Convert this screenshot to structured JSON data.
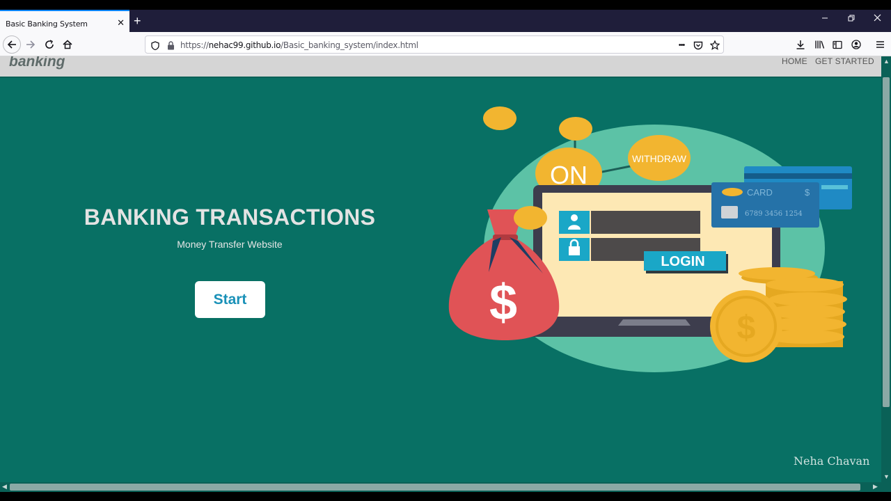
{
  "browser": {
    "tab_title": "Basic Banking System",
    "tab_close": "✕",
    "new_tab": "+",
    "url_prefix": "https://",
    "url_host": "nehac99.github.io",
    "url_path": "/Basic_banking_system/index.html",
    "page_actions": "•••"
  },
  "site": {
    "brand": "banking",
    "nav": [
      "HOME",
      "GET STARTED"
    ]
  },
  "hero": {
    "title": "BANKING TRANSACTIONS",
    "subtitle": "Money Transfer Website",
    "start_label": "Start"
  },
  "illustration": {
    "bubble_on": "ON",
    "bubble_withdraw": "WITHDRAW",
    "card_label": "CARD",
    "card_currency": "$",
    "card_number": "6789 3456 1254",
    "login_label": "LOGIN",
    "bag_symbol": "$",
    "coin_symbol": "$"
  },
  "watermark": "Neha Chavan",
  "colors": {
    "page_bg": "#087064",
    "site_nav_bg": "#d5d5d5",
    "start_text": "#1a91b8",
    "ellipse": "#5cc2a6",
    "coin": "#f2b530",
    "bag": "#e05356"
  }
}
